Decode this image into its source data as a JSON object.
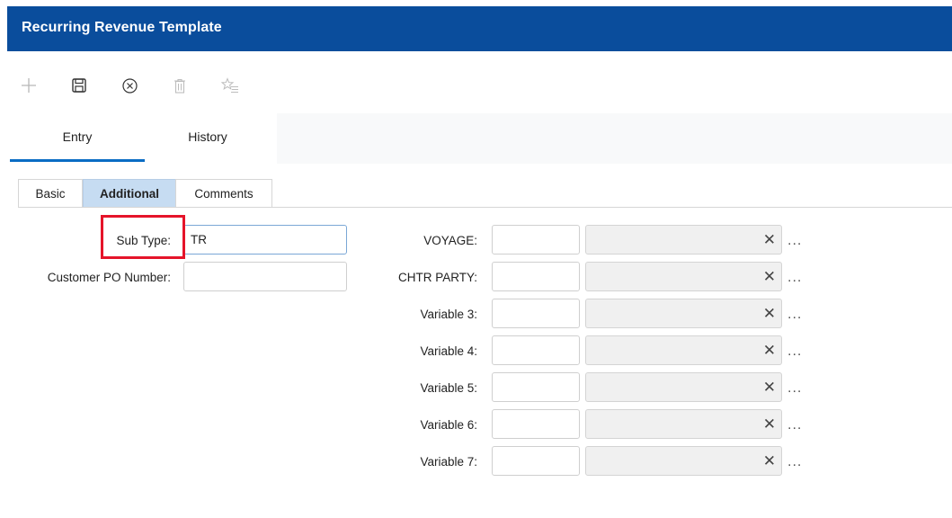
{
  "window": {
    "title": "Recurring Revenue Template"
  },
  "toolbar": {
    "buttons": [
      {
        "icon": "plus-icon"
      },
      {
        "icon": "save-icon"
      },
      {
        "icon": "cancel-icon"
      },
      {
        "icon": "trash-icon"
      },
      {
        "icon": "favorite-icon"
      }
    ]
  },
  "tabs": [
    {
      "label": "Entry",
      "active": true
    },
    {
      "label": "History",
      "active": false
    }
  ],
  "subtabs": [
    {
      "label": "Basic",
      "active": false
    },
    {
      "label": "Additional",
      "active": true
    },
    {
      "label": "Comments",
      "active": false
    }
  ],
  "form": {
    "sub_type": {
      "label": "Sub Type:",
      "value": "TR"
    },
    "customer_po": {
      "label": "Customer PO Number:",
      "value": ""
    }
  },
  "variables": [
    {
      "label": "VOYAGE:",
      "code": "",
      "description": ""
    },
    {
      "label": "CHTR PARTY:",
      "code": "",
      "description": ""
    },
    {
      "label": "Variable 3:",
      "code": "",
      "description": ""
    },
    {
      "label": "Variable 4:",
      "code": "",
      "description": ""
    },
    {
      "label": "Variable 5:",
      "code": "",
      "description": ""
    },
    {
      "label": "Variable 6:",
      "code": "",
      "description": ""
    },
    {
      "label": "Variable 7:",
      "code": "",
      "description": ""
    }
  ],
  "glyphs": {
    "clear": "✕",
    "more": "..."
  },
  "colors": {
    "header": "#0a4d9c",
    "tab_underline": "#0a6cc4",
    "active_subtab": "#c6dcf2",
    "highlight": "#e5142a"
  }
}
